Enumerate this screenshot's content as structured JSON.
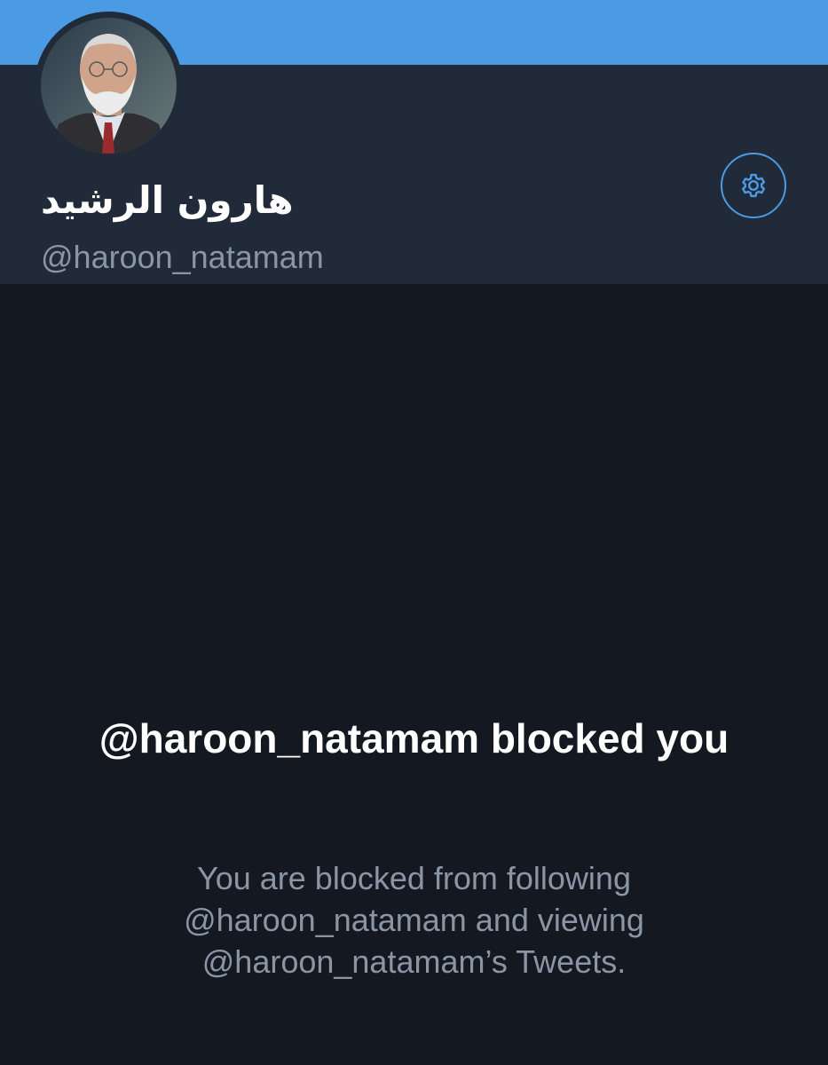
{
  "profile": {
    "display_name": "هارون الرشید",
    "handle": "@haroon_natamam",
    "avatar_alt": "profile photo"
  },
  "header": {
    "settings_icon": "gear-icon"
  },
  "blocked_notice": {
    "title": "@haroon_natamam blocked you",
    "description": "You are blocked from following @haroon_natamam and viewing @haroon_natamam’s Tweets."
  },
  "colors": {
    "banner": "#4a9be4",
    "header_bg": "#212a38",
    "page_bg": "#141820",
    "accent": "#4a9be4",
    "secondary_text": "#8a96a6"
  }
}
